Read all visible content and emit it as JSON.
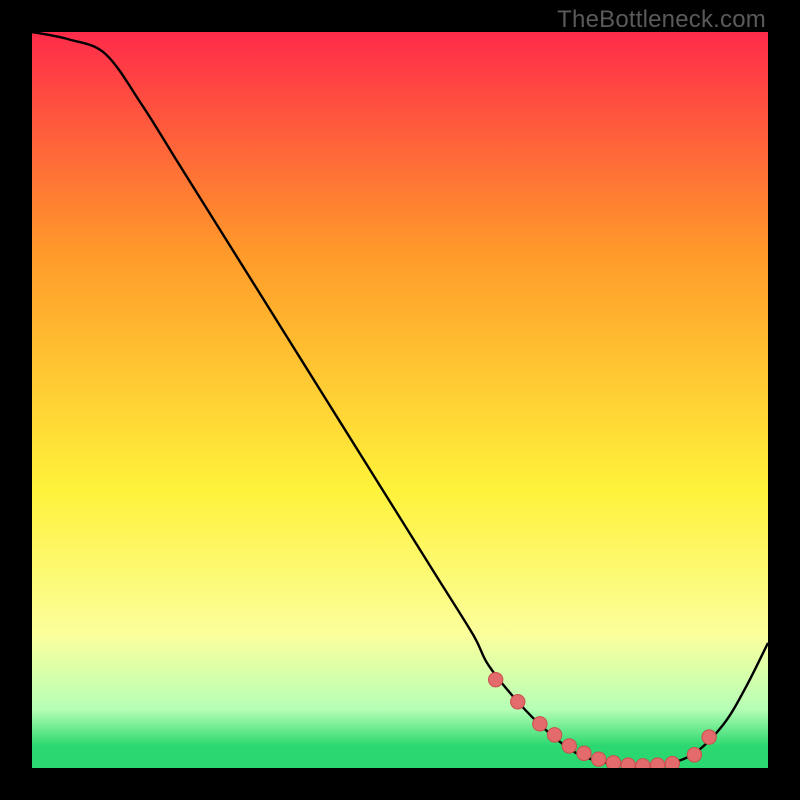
{
  "watermark": "TheBottleneck.com",
  "colors": {
    "top_red": "#ff2b4a",
    "mid_orange": "#ff9a2a",
    "mid_yellow": "#fff23a",
    "light_yellow": "#fbff9d",
    "pale_green": "#b6ffb6",
    "green": "#2bd86f",
    "curve": "#000000",
    "marker_fill": "#e46b6b",
    "marker_stroke": "#c94f4f",
    "frame": "#000000"
  },
  "chart_data": {
    "type": "line",
    "title": "",
    "xlabel": "",
    "ylabel": "",
    "xlim": [
      0,
      100
    ],
    "ylim": [
      0,
      100
    ],
    "curve": {
      "x": [
        0,
        5,
        10,
        15,
        20,
        25,
        30,
        35,
        40,
        45,
        50,
        55,
        60,
        62,
        66,
        70,
        74,
        78,
        82,
        86,
        90,
        94,
        97,
        100
      ],
      "y": [
        100,
        99,
        97,
        90,
        82,
        74,
        66,
        58,
        50,
        42,
        34,
        26,
        18,
        14,
        9,
        5,
        2,
        0.7,
        0.3,
        0.5,
        2,
        6,
        11,
        17
      ]
    },
    "markers": {
      "x": [
        63,
        66,
        69,
        71,
        73,
        75,
        77,
        79,
        81,
        83,
        85,
        87,
        90,
        92
      ],
      "y": [
        12,
        9,
        6,
        4.5,
        3,
        2,
        1.2,
        0.7,
        0.4,
        0.3,
        0.4,
        0.6,
        1.8,
        4.2
      ]
    }
  }
}
